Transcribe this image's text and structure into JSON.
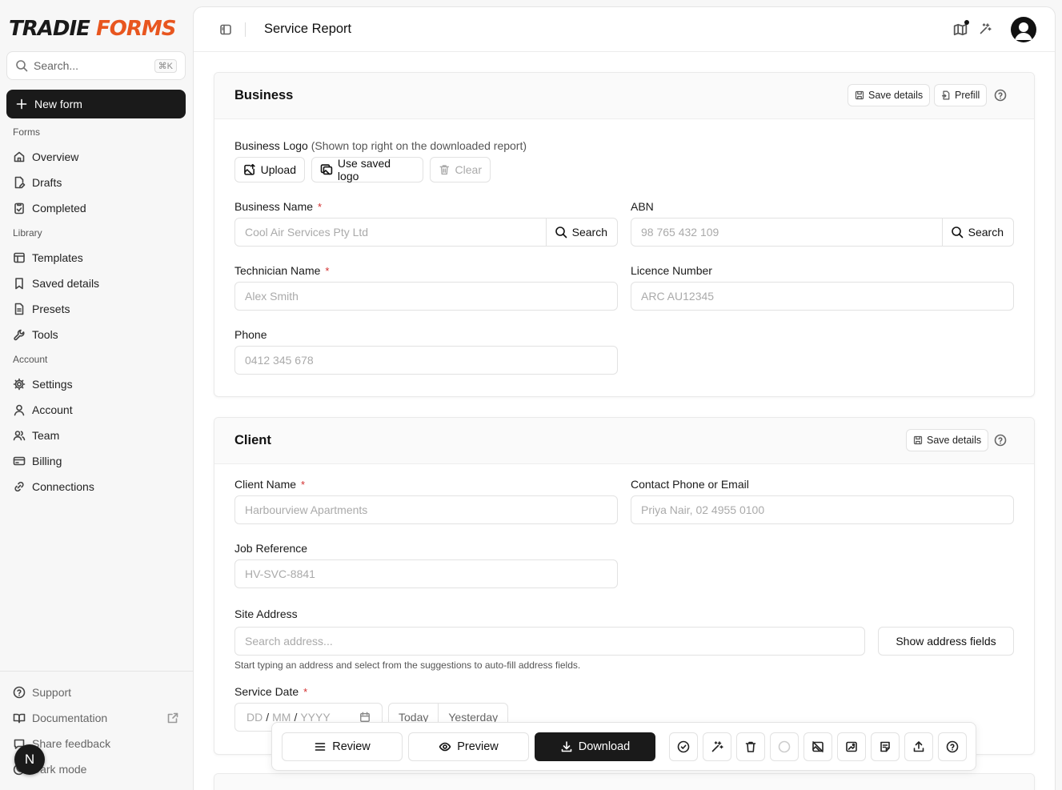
{
  "brand": {
    "part1": "TRADIE",
    "part2": "FORMS",
    "accent": "#e8561f"
  },
  "sidebar": {
    "search_placeholder": "Search...",
    "search_shortcut": "⌘K",
    "new_form": "New form",
    "sections": {
      "forms": "Forms",
      "library": "Library",
      "account": "Account"
    },
    "items": {
      "overview": "Overview",
      "drafts": "Drafts",
      "completed": "Completed",
      "templates": "Templates",
      "saved_details": "Saved details",
      "presets": "Presets",
      "tools": "Tools",
      "settings": "Settings",
      "account": "Account",
      "team": "Team",
      "billing": "Billing",
      "connections": "Connections"
    },
    "bottom": {
      "support": "Support",
      "documentation": "Documentation",
      "share_feedback": "Share feedback",
      "dark_mode": "Dark mode"
    },
    "user_initial": "N"
  },
  "header": {
    "title": "Service Report"
  },
  "business": {
    "title": "Business",
    "save_details": "Save details",
    "prefill": "Prefill",
    "logo_label": "Business Logo",
    "logo_hint": "(Shown top right on the downloaded report)",
    "upload": "Upload",
    "use_saved_logo": "Use saved logo",
    "clear": "Clear",
    "business_name_label": "Business Name",
    "business_name_placeholder": "Cool Air Services Pty Ltd",
    "search": "Search",
    "abn_label": "ABN",
    "abn_placeholder": "98 765 432 109",
    "technician_label": "Technician Name",
    "technician_placeholder": "Alex Smith",
    "licence_label": "Licence Number",
    "licence_placeholder": "ARC AU12345",
    "phone_label": "Phone",
    "phone_placeholder": "0412 345 678",
    "required_mark": "*"
  },
  "client": {
    "title": "Client",
    "save_details": "Save details",
    "client_name_label": "Client Name",
    "client_name_placeholder": "Harbourview Apartments",
    "contact_label": "Contact Phone or Email",
    "contact_placeholder": "Priya Nair, 02 4955 0100",
    "job_ref_label": "Job Reference",
    "job_ref_placeholder": "HV-SVC-8841",
    "site_address_label": "Site Address",
    "site_address_placeholder": "Search address...",
    "show_address_fields": "Show address fields",
    "address_helper": "Start typing an address and select from the suggestions to auto-fill address fields.",
    "service_date_label": "Service Date",
    "date_dd": "DD",
    "date_mm": "MM",
    "date_yyyy": "YYYY",
    "date_sep": "/",
    "today": "Today",
    "yesterday": "Yesterday",
    "required_mark": "*"
  },
  "toolbar": {
    "review": "Review",
    "preview": "Preview",
    "download": "Download"
  }
}
